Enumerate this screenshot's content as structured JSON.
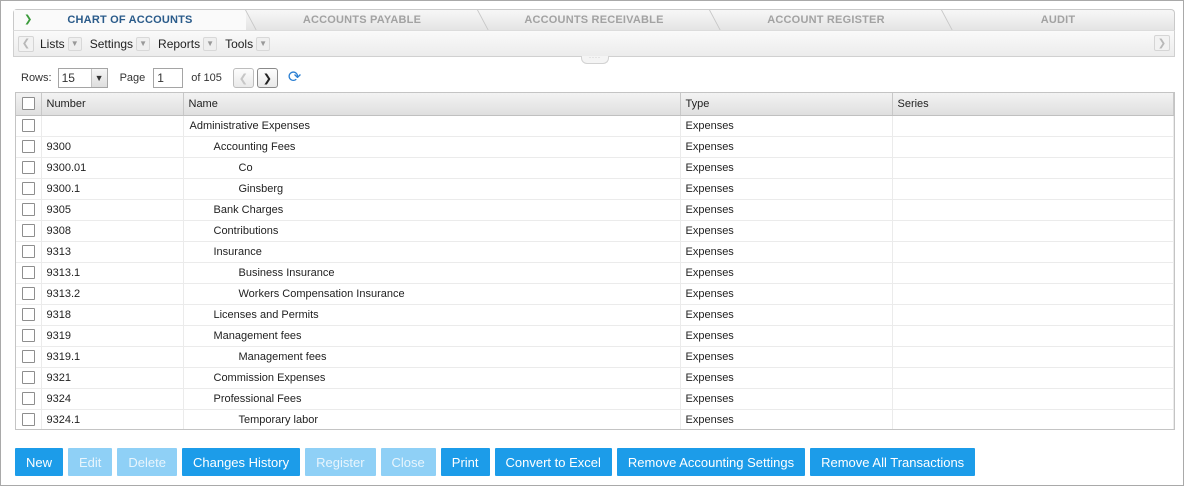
{
  "tabs": [
    {
      "label": "CHART OF ACCOUNTS",
      "active": true
    },
    {
      "label": "ACCOUNTS PAYABLE",
      "active": false
    },
    {
      "label": "ACCOUNTS RECEIVABLE",
      "active": false
    },
    {
      "label": "ACCOUNT REGISTER",
      "active": false
    },
    {
      "label": "AUDIT",
      "active": false
    }
  ],
  "menu": {
    "items": [
      "Lists",
      "Settings",
      "Reports",
      "Tools"
    ]
  },
  "pager": {
    "rows_label": "Rows:",
    "rows_value": "15",
    "page_label": "Page",
    "page_value": "1",
    "of_label": "of 105"
  },
  "grid": {
    "columns": [
      "Number",
      "Name",
      "Type",
      "Series"
    ],
    "rows": [
      {
        "number": "",
        "name": "Administrative Expenses",
        "type": "Expenses",
        "series": "",
        "level": 0
      },
      {
        "number": "9300",
        "name": "Accounting Fees",
        "type": "Expenses",
        "series": "",
        "level": 1
      },
      {
        "number": "9300.01",
        "name": "Co",
        "type": "Expenses",
        "series": "",
        "level": 2
      },
      {
        "number": "9300.1",
        "name": "Ginsberg",
        "type": "Expenses",
        "series": "",
        "level": 2
      },
      {
        "number": "9305",
        "name": "Bank Charges",
        "type": "Expenses",
        "series": "",
        "level": 1
      },
      {
        "number": "9308",
        "name": "Contributions",
        "type": "Expenses",
        "series": "",
        "level": 1
      },
      {
        "number": "9313",
        "name": "Insurance",
        "type": "Expenses",
        "series": "",
        "level": 1
      },
      {
        "number": "9313.1",
        "name": "Business Insurance",
        "type": "Expenses",
        "series": "",
        "level": 2
      },
      {
        "number": "9313.2",
        "name": "Workers Compensation Insurance",
        "type": "Expenses",
        "series": "",
        "level": 2
      },
      {
        "number": "9318",
        "name": "Licenses and Permits",
        "type": "Expenses",
        "series": "",
        "level": 1
      },
      {
        "number": "9319",
        "name": "Management fees",
        "type": "Expenses",
        "series": "",
        "level": 1
      },
      {
        "number": "9319.1",
        "name": "Management fees",
        "type": "Expenses",
        "series": "",
        "level": 2
      },
      {
        "number": "9321",
        "name": "Commission Expenses",
        "type": "Expenses",
        "series": "",
        "level": 1
      },
      {
        "number": "9324",
        "name": "Professional Fees",
        "type": "Expenses",
        "series": "",
        "level": 1
      },
      {
        "number": "9324.1",
        "name": "Temporary labor",
        "type": "Expenses",
        "series": "",
        "level": 2
      }
    ]
  },
  "buttons": [
    {
      "id": "new",
      "label": "New",
      "enabled": true
    },
    {
      "id": "edit",
      "label": "Edit",
      "enabled": false
    },
    {
      "id": "delete",
      "label": "Delete",
      "enabled": false
    },
    {
      "id": "changes-history",
      "label": "Changes History",
      "enabled": true
    },
    {
      "id": "register",
      "label": "Register",
      "enabled": false
    },
    {
      "id": "close",
      "label": "Close",
      "enabled": false
    },
    {
      "id": "print",
      "label": "Print",
      "enabled": true
    },
    {
      "id": "convert-to-excel",
      "label": "Convert to Excel",
      "enabled": true
    },
    {
      "id": "remove-accounting-settings",
      "label": "Remove Accounting Settings",
      "enabled": true
    },
    {
      "id": "remove-all-transactions",
      "label": "Remove All Transactions",
      "enabled": true
    }
  ],
  "colors": {
    "accent": "#1c9ce9",
    "accent_disabled": "#8fd0f6",
    "tab_active_text": "#2a5b8a",
    "tab_inactive_text": "#a2a2a2"
  },
  "icons": {
    "active_tab": "chevron-right-icon",
    "refresh": "refresh-icon"
  }
}
